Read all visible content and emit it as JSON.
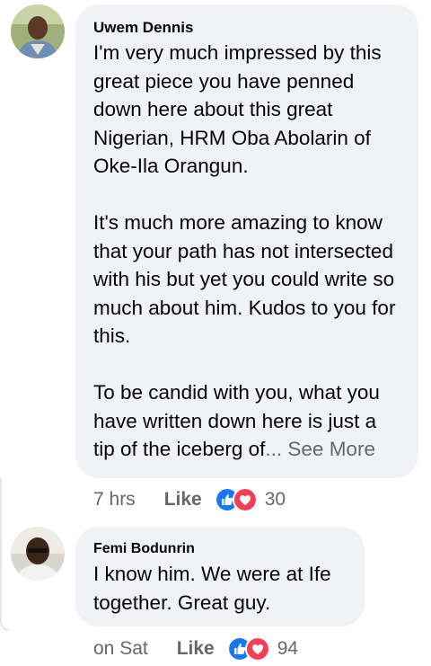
{
  "comments": [
    {
      "author": "Uwem Dennis",
      "paragraphs": [
        "I'm very much impressed by this great piece you have penned down here about this great Nigerian, HRM Oba Abolarin of Oke-Ila Orangun.",
        "It's much more amazing to know that your path has not intersected with his but yet you could write so much about him. Kudos to you for this.",
        "To be candid with you, what you have written down here is just a tip of the iceberg of"
      ],
      "ellipsis": "...",
      "see_more": "See More",
      "time": "7 hrs",
      "like_label": "Like",
      "reaction_count": "30"
    },
    {
      "author": "Femi Bodunrin",
      "paragraphs": [
        "I know him. We were at Ife together. Great guy."
      ],
      "time": "on Sat",
      "like_label": "Like",
      "reaction_count": "94"
    }
  ],
  "icons": {
    "like_reaction": "thumbs-up-icon",
    "love_reaction": "heart-icon"
  },
  "colors": {
    "bubble_bg": "#f0f2f5",
    "meta_text": "#65676b",
    "like_blue": "#1877f2",
    "love_red": "#f33e58"
  }
}
